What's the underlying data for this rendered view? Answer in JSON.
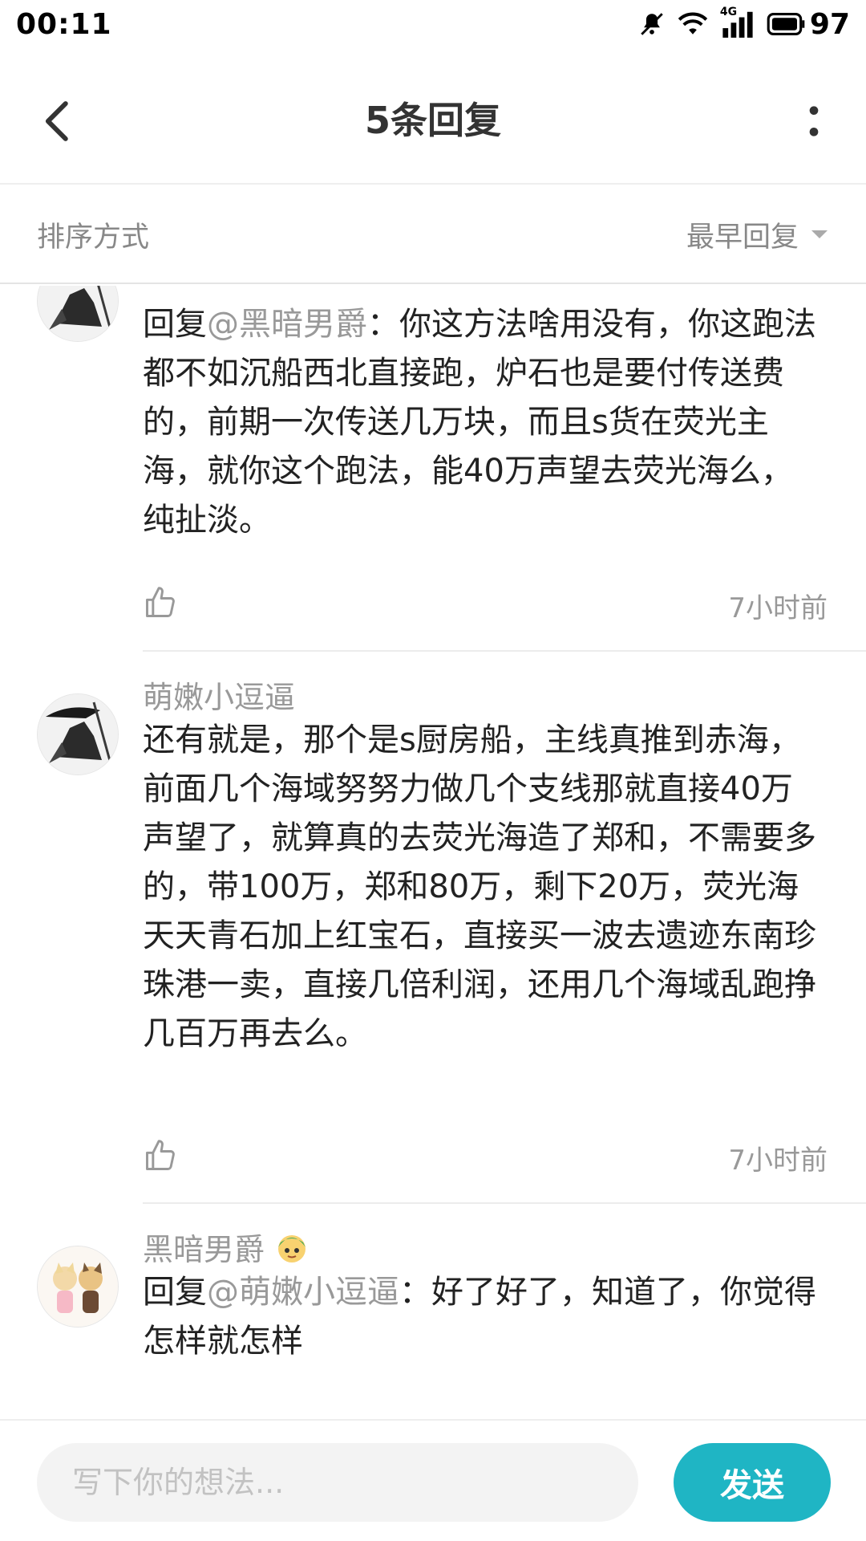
{
  "status_bar": {
    "time": "00:11",
    "network": "4G",
    "battery": "97"
  },
  "header": {
    "title": "5条回复"
  },
  "sort": {
    "label": "排序方式",
    "selected": "最早回复"
  },
  "replies": [
    {
      "user": "",
      "mention_prefix": "回复",
      "mention": "@黑暗男爵",
      "text": "：你这方法啥用没有，你这跑法都不如沉船西北直接跑，炉石也是要付传送费的，前期一次传送几万块，而且s货在荧光主海，就你这个跑法，能40万声望去荧光海么，纯扯淡。",
      "time": "7小时前"
    },
    {
      "user": "萌嫩小逗逼",
      "text": "还有就是，那个是s厨房船，主线真推到赤海，前面几个海域努努力做几个支线那就直接40万声望了，就算真的去荧光海造了郑和，不需要多的，带100万，郑和80万，剩下20万，荧光海天天青石加上红宝石，直接买一波去遗迹东南珍珠港一卖，直接几倍利润，还用几个海域乱跑挣几百万再去么。",
      "time": "7小时前"
    },
    {
      "user": "黑暗男爵",
      "mention_prefix": "回复",
      "mention": "@萌嫩小逗逼",
      "text": "：好了好了，知道了，你觉得怎样就怎样"
    }
  ],
  "composer": {
    "placeholder": "写下你的想法...",
    "send_label": "发送"
  },
  "colors": {
    "accent": "#1fb5c4",
    "secondary_text": "#999999"
  }
}
